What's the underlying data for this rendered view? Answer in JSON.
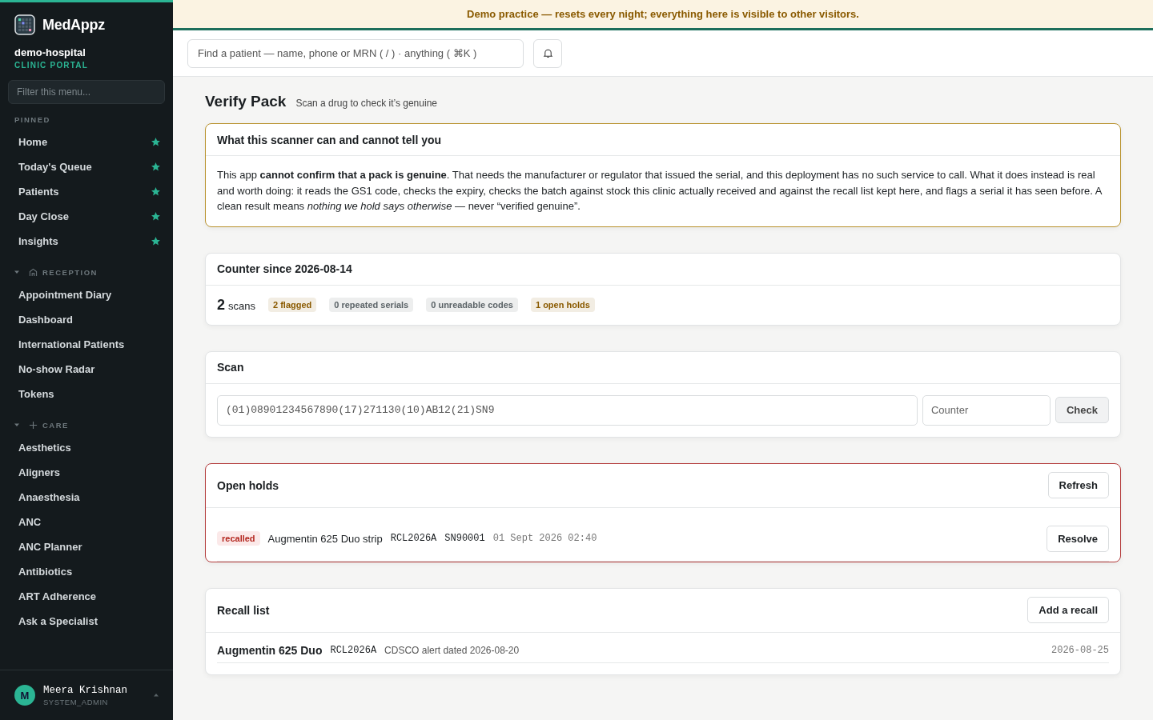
{
  "sidebar": {
    "brand": "MedAppz",
    "org": "demo-hospital",
    "portal": "CLINIC PORTAL",
    "filter_placeholder": "Filter this menu...",
    "sections": [
      {
        "label": "PINNED",
        "kind": "plain",
        "items": [
          {
            "label": "Home",
            "starred": true
          },
          {
            "label": "Today's Queue",
            "starred": true
          },
          {
            "label": "Patients",
            "starred": true
          },
          {
            "label": "Day Close",
            "starred": true
          },
          {
            "label": "Insights",
            "starred": true
          }
        ]
      },
      {
        "label": "RECEPTION",
        "kind": "house",
        "items": [
          {
            "label": "Appointment Diary",
            "starred": false
          },
          {
            "label": "Dashboard",
            "starred": false
          },
          {
            "label": "International Patients",
            "starred": false
          },
          {
            "label": "No-show Radar",
            "starred": false
          },
          {
            "label": "Tokens",
            "starred": false
          }
        ]
      },
      {
        "label": "CARE",
        "kind": "plus",
        "items": [
          {
            "label": "Aesthetics",
            "starred": false
          },
          {
            "label": "Aligners",
            "starred": false
          },
          {
            "label": "Anaesthesia",
            "starred": false
          },
          {
            "label": "ANC",
            "starred": false
          },
          {
            "label": "ANC Planner",
            "starred": false
          },
          {
            "label": "Antibiotics",
            "starred": false
          },
          {
            "label": "ART Adherence",
            "starred": false
          },
          {
            "label": "Ask a Specialist",
            "starred": false
          }
        ]
      }
    ],
    "user": {
      "initial": "M",
      "name": "Meera Krishnan",
      "role": "SYSTEM_ADMIN"
    }
  },
  "banner": "Demo practice — resets every night; everything here is visible to other visitors.",
  "search": {
    "placeholder": "Find a patient — name, phone or MRN ( / ) · anything ( ⌘K )"
  },
  "page": {
    "title": "Verify Pack",
    "subtitle": "Scan a drug to check it’s genuine"
  },
  "notice": {
    "title": "What this scanner can and cannot tell you",
    "body": "This app **cannot confirm that a pack is genuine**. That needs the manufacturer or regulator that issued the serial, and this deployment has no such service to call. What it does instead is real and worth doing: it reads the GS1 code, checks the expiry, checks the batch against stock this clinic actually received and against the recall list kept here, and flags a serial it has seen before. A clean result means *nothing we hold says otherwise* — never “verified genuine”."
  },
  "counter": {
    "title": "Counter since 2026-08-14",
    "count": "2",
    "unit": "scans",
    "pills": [
      {
        "label": "2 flagged",
        "color": "#8a5a00"
      },
      {
        "label": "0 repeated serials",
        "color": "#5b6367"
      },
      {
        "label": "0 unreadable codes",
        "color": "#5b6367"
      },
      {
        "label": "1 open holds",
        "color": "#8a5a00"
      }
    ]
  },
  "scan": {
    "title": "Scan",
    "code": "(01)08901234567890(17)271130(10)AB12(21)SN9",
    "counter_placeholder": "Counter",
    "button": "Check"
  },
  "holds": {
    "title": "Open holds",
    "button": "Refresh",
    "rows": [
      {
        "status": "recalled",
        "name": "Augmentin 625 Duo strip",
        "batch": "RCL2026A",
        "serial": "SN90001",
        "time": "01 Sept 2026 02:40",
        "action": "Resolve"
      }
    ]
  },
  "recalls": {
    "title": "Recall list",
    "button": "Add a recall",
    "rows": [
      {
        "name": "Augmentin 625 Duo",
        "batch": "RCL2026A",
        "note": "CDSCO alert dated 2026-08-20",
        "date": "2026-08-25"
      }
    ]
  }
}
